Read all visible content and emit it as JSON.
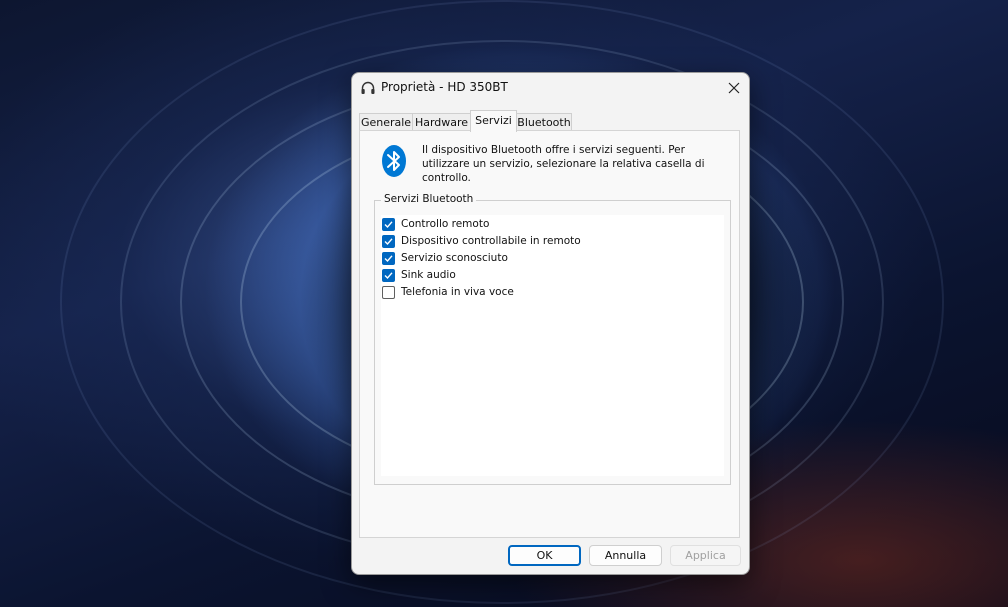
{
  "window": {
    "title": "Proprietà - HD 350BT",
    "icon": "headphones-icon",
    "close_icon": "close-icon"
  },
  "tabs": [
    {
      "label": "Generale",
      "active": false
    },
    {
      "label": "Hardware",
      "active": false
    },
    {
      "label": "Servizi",
      "active": true
    },
    {
      "label": "Bluetooth",
      "active": false
    }
  ],
  "services_tab": {
    "icon": "bluetooth-icon",
    "description": "Il dispositivo Bluetooth offre i servizi seguenti. Per utilizzare un servizio, selezionare la relativa casella di controllo.",
    "group_label": "Servizi Bluetooth",
    "services": [
      {
        "label": "Controllo remoto",
        "checked": true
      },
      {
        "label": "Dispositivo controllabile in remoto",
        "checked": true
      },
      {
        "label": "Servizio sconosciuto",
        "checked": true
      },
      {
        "label": "Sink audio",
        "checked": true
      },
      {
        "label": "Telefonia in viva voce",
        "checked": false
      }
    ]
  },
  "buttons": {
    "ok": "OK",
    "cancel": "Annulla",
    "apply": "Applica"
  },
  "colors": {
    "accent": "#0067c0",
    "bluetooth_blue": "#0078d4",
    "dialog_bg": "#f3f3f3"
  }
}
